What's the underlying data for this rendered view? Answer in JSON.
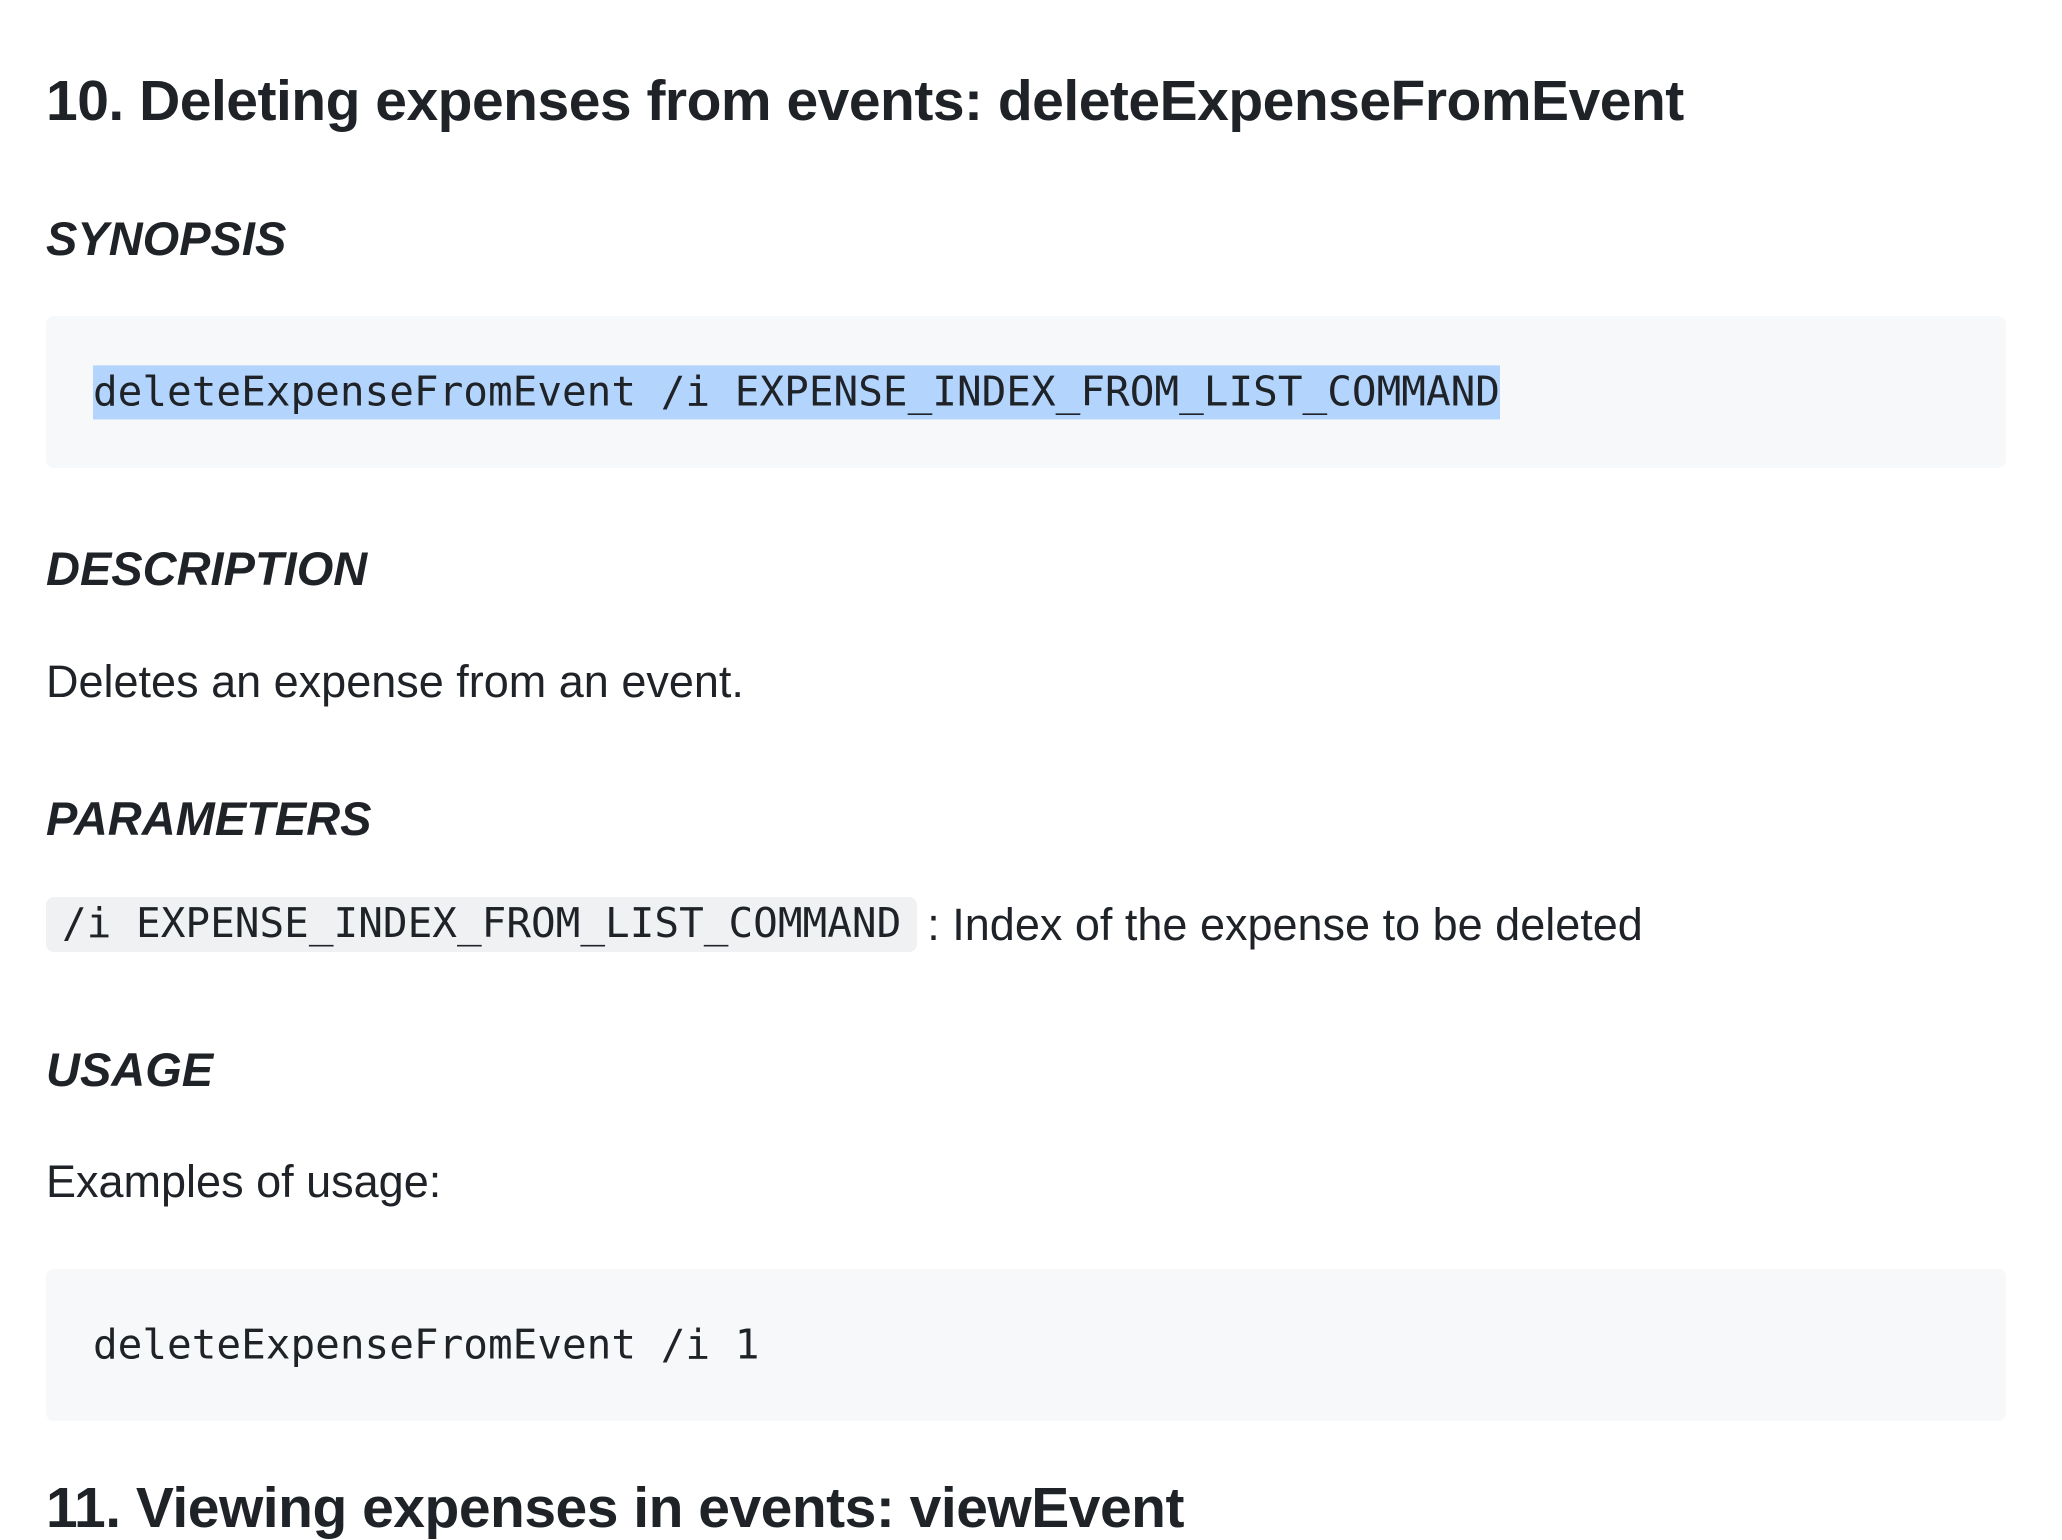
{
  "section10": {
    "title": "10. Deleting expenses from events: deleteExpenseFromEvent",
    "synopsis_heading": "SYNOPSIS",
    "synopsis_code": "deleteExpenseFromEvent /i EXPENSE_INDEX_FROM_LIST_COMMAND",
    "description_heading": "DESCRIPTION",
    "description_text": "Deletes an expense from an event.",
    "parameters_heading": "PARAMETERS",
    "parameter_code": "/i EXPENSE_INDEX_FROM_LIST_COMMAND",
    "parameter_desc": ": Index of the expense to be deleted",
    "usage_heading": "USAGE",
    "usage_intro": "Examples of usage:",
    "usage_code": "deleteExpenseFromEvent /i 1"
  },
  "section11": {
    "title": "11. Viewing expenses in events: viewEvent"
  },
  "colors": {
    "text": "#1f2328",
    "code_block_bg": "#f6f8fa",
    "inline_code_bg": "#eff1f3",
    "selection": "#b3d4fc"
  }
}
